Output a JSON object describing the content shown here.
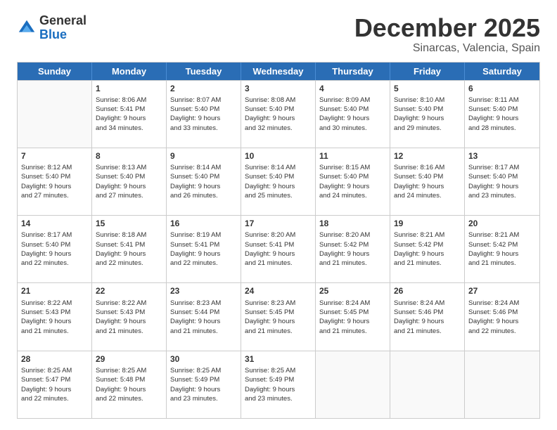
{
  "logo": {
    "general": "General",
    "blue": "Blue"
  },
  "title": "December 2025",
  "subtitle": "Sinarcas, Valencia, Spain",
  "days": [
    "Sunday",
    "Monday",
    "Tuesday",
    "Wednesday",
    "Thursday",
    "Friday",
    "Saturday"
  ],
  "weeks": [
    [
      {
        "day": "",
        "content": ""
      },
      {
        "day": "1",
        "content": "Sunrise: 8:06 AM\nSunset: 5:41 PM\nDaylight: 9 hours\nand 34 minutes."
      },
      {
        "day": "2",
        "content": "Sunrise: 8:07 AM\nSunset: 5:40 PM\nDaylight: 9 hours\nand 33 minutes."
      },
      {
        "day": "3",
        "content": "Sunrise: 8:08 AM\nSunset: 5:40 PM\nDaylight: 9 hours\nand 32 minutes."
      },
      {
        "day": "4",
        "content": "Sunrise: 8:09 AM\nSunset: 5:40 PM\nDaylight: 9 hours\nand 30 minutes."
      },
      {
        "day": "5",
        "content": "Sunrise: 8:10 AM\nSunset: 5:40 PM\nDaylight: 9 hours\nand 29 minutes."
      },
      {
        "day": "6",
        "content": "Sunrise: 8:11 AM\nSunset: 5:40 PM\nDaylight: 9 hours\nand 28 minutes."
      }
    ],
    [
      {
        "day": "7",
        "content": "Sunrise: 8:12 AM\nSunset: 5:40 PM\nDaylight: 9 hours\nand 27 minutes."
      },
      {
        "day": "8",
        "content": "Sunrise: 8:13 AM\nSunset: 5:40 PM\nDaylight: 9 hours\nand 27 minutes."
      },
      {
        "day": "9",
        "content": "Sunrise: 8:14 AM\nSunset: 5:40 PM\nDaylight: 9 hours\nand 26 minutes."
      },
      {
        "day": "10",
        "content": "Sunrise: 8:14 AM\nSunset: 5:40 PM\nDaylight: 9 hours\nand 25 minutes."
      },
      {
        "day": "11",
        "content": "Sunrise: 8:15 AM\nSunset: 5:40 PM\nDaylight: 9 hours\nand 24 minutes."
      },
      {
        "day": "12",
        "content": "Sunrise: 8:16 AM\nSunset: 5:40 PM\nDaylight: 9 hours\nand 24 minutes."
      },
      {
        "day": "13",
        "content": "Sunrise: 8:17 AM\nSunset: 5:40 PM\nDaylight: 9 hours\nand 23 minutes."
      }
    ],
    [
      {
        "day": "14",
        "content": "Sunrise: 8:17 AM\nSunset: 5:40 PM\nDaylight: 9 hours\nand 22 minutes."
      },
      {
        "day": "15",
        "content": "Sunrise: 8:18 AM\nSunset: 5:41 PM\nDaylight: 9 hours\nand 22 minutes."
      },
      {
        "day": "16",
        "content": "Sunrise: 8:19 AM\nSunset: 5:41 PM\nDaylight: 9 hours\nand 22 minutes."
      },
      {
        "day": "17",
        "content": "Sunrise: 8:20 AM\nSunset: 5:41 PM\nDaylight: 9 hours\nand 21 minutes."
      },
      {
        "day": "18",
        "content": "Sunrise: 8:20 AM\nSunset: 5:42 PM\nDaylight: 9 hours\nand 21 minutes."
      },
      {
        "day": "19",
        "content": "Sunrise: 8:21 AM\nSunset: 5:42 PM\nDaylight: 9 hours\nand 21 minutes."
      },
      {
        "day": "20",
        "content": "Sunrise: 8:21 AM\nSunset: 5:42 PM\nDaylight: 9 hours\nand 21 minutes."
      }
    ],
    [
      {
        "day": "21",
        "content": "Sunrise: 8:22 AM\nSunset: 5:43 PM\nDaylight: 9 hours\nand 21 minutes."
      },
      {
        "day": "22",
        "content": "Sunrise: 8:22 AM\nSunset: 5:43 PM\nDaylight: 9 hours\nand 21 minutes."
      },
      {
        "day": "23",
        "content": "Sunrise: 8:23 AM\nSunset: 5:44 PM\nDaylight: 9 hours\nand 21 minutes."
      },
      {
        "day": "24",
        "content": "Sunrise: 8:23 AM\nSunset: 5:45 PM\nDaylight: 9 hours\nand 21 minutes."
      },
      {
        "day": "25",
        "content": "Sunrise: 8:24 AM\nSunset: 5:45 PM\nDaylight: 9 hours\nand 21 minutes."
      },
      {
        "day": "26",
        "content": "Sunrise: 8:24 AM\nSunset: 5:46 PM\nDaylight: 9 hours\nand 21 minutes."
      },
      {
        "day": "27",
        "content": "Sunrise: 8:24 AM\nSunset: 5:46 PM\nDaylight: 9 hours\nand 22 minutes."
      }
    ],
    [
      {
        "day": "28",
        "content": "Sunrise: 8:25 AM\nSunset: 5:47 PM\nDaylight: 9 hours\nand 22 minutes."
      },
      {
        "day": "29",
        "content": "Sunrise: 8:25 AM\nSunset: 5:48 PM\nDaylight: 9 hours\nand 22 minutes."
      },
      {
        "day": "30",
        "content": "Sunrise: 8:25 AM\nSunset: 5:49 PM\nDaylight: 9 hours\nand 23 minutes."
      },
      {
        "day": "31",
        "content": "Sunrise: 8:25 AM\nSunset: 5:49 PM\nDaylight: 9 hours\nand 23 minutes."
      },
      {
        "day": "",
        "content": ""
      },
      {
        "day": "",
        "content": ""
      },
      {
        "day": "",
        "content": ""
      }
    ]
  ]
}
